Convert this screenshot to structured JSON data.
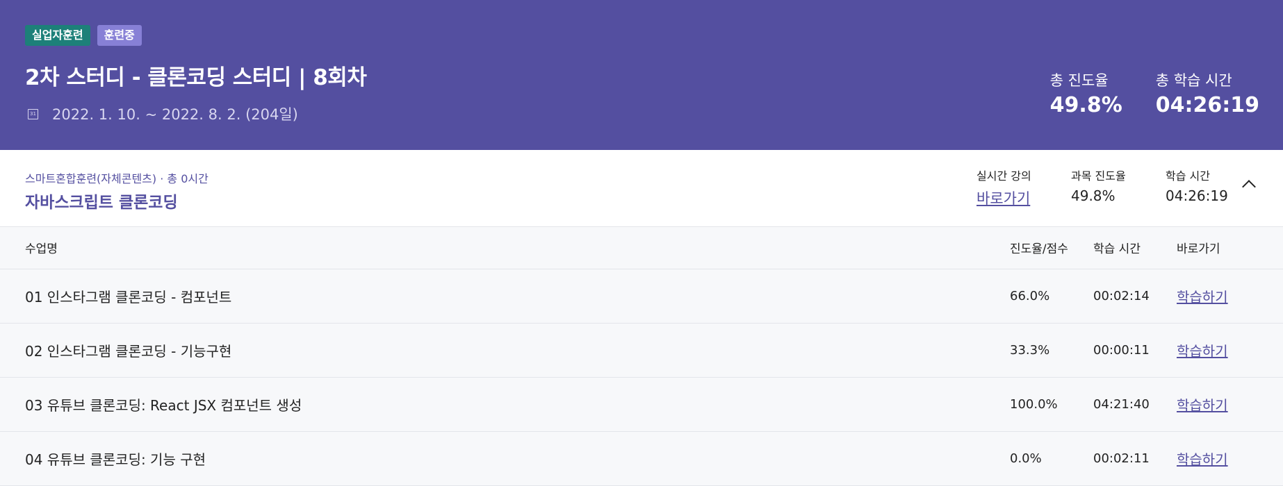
{
  "header": {
    "badges": [
      "실업자훈련",
      "훈련중"
    ],
    "title": "2차 스터디 - 클론코딩 스터디 | 8회차",
    "calendar_icon_text": "31",
    "period": "2022. 1. 10. ~ 2022. 8. 2. (204일)",
    "total_progress_label": "총 진도율",
    "total_progress_value": "49.8%",
    "total_time_label": "총 학습 시간",
    "total_time_value": "04:26:19"
  },
  "subject": {
    "category": "스마트혼합훈련(자체콘텐츠) · 총 0시간",
    "name": "자바스크립트 클론코딩",
    "live_label": "실시간 강의",
    "live_link": "바로가기",
    "progress_label": "과목 진도율",
    "progress_value": "49.8%",
    "time_label": "학습 시간",
    "time_value": "04:26:19"
  },
  "table": {
    "headers": [
      "수업명",
      "진도율/점수",
      "학습 시간",
      "바로가기"
    ],
    "rows": [
      {
        "name": "01 인스타그램 클론코딩 - 컴포넌트",
        "progress": "66.0%",
        "time": "00:02:14",
        "action": "학습하기"
      },
      {
        "name": "02 인스타그램 클론코딩 - 기능구현",
        "progress": "33.3%",
        "time": "00:00:11",
        "action": "학습하기"
      },
      {
        "name": "03 유튜브 클론코딩: React JSX 컴포넌트 생성",
        "progress": "100.0%",
        "time": "04:21:40",
        "action": "학습하기"
      },
      {
        "name": "04 유튜브 클론코딩: 기능 구현",
        "progress": "0.0%",
        "time": "00:02:11",
        "action": "학습하기"
      }
    ]
  },
  "icons": {
    "calendar": "calendar-icon",
    "collapse": "chevron-up-icon"
  }
}
